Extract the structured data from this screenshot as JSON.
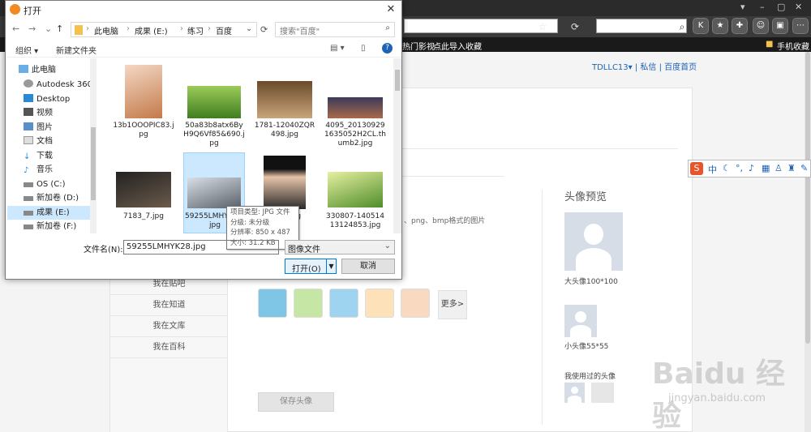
{
  "browser": {
    "bookmarks": [
      "热门影视",
      "点此导入收藏",
      "手机收藏"
    ],
    "user_links": "TDLLC13▾  |  私信  |  百度首页"
  },
  "page": {
    "sidebar": [
      "我在贴吧",
      "我在知道",
      "我在文库",
      "我在百科"
    ],
    "hint": "、png、bmp格式的图片",
    "more": "更多>",
    "save_avatar": "保存头像",
    "preview_title": "头像预览",
    "big_avatar": "大头像100*100",
    "small_avatar": "小头像55*55",
    "used_avatars": "我使用过的头像",
    "ime_label": "中",
    "watermark": "Baidu 经验",
    "watermark_url": "jingyan.baidu.com"
  },
  "dialog": {
    "title": "打开",
    "path": [
      "此电脑",
      "成果 (E:)",
      "练习",
      "百度"
    ],
    "search_placeholder": "搜索\"百度\"",
    "organize": "组织 ▾",
    "new_folder": "新建文件夹",
    "nav": [
      "此电脑",
      "Autodesk 360",
      "Desktop",
      "视频",
      "图片",
      "文档",
      "下载",
      "音乐",
      "OS (C:)",
      "新加卷 (D:)",
      "成果 (E:)",
      "新加卷 (F:)"
    ],
    "files": [
      {
        "name": "13b1OOOPIC83.jpg"
      },
      {
        "name": "50a83b8atx6ByH9Q6Vf85&690.jpg"
      },
      {
        "name": "1781-12040ZQR498.jpg"
      },
      {
        "name": "4095_201309291635052H2CL.thumb2.jpg"
      },
      {
        "name": "7183_7.jpg"
      },
      {
        "name": "59255LMHYK28.jpg"
      },
      {
        "name": "061Z.jpg"
      },
      {
        "name": "330807-14051413124853.jpg"
      }
    ],
    "tooltip": [
      "项目类型: JPG 文件",
      "分级: 未分级",
      "分辨率: 850 x 487",
      "大小: 31.2 KB"
    ],
    "filename_label": "文件名(N):",
    "filename_value": "59255LMHYK28.jpg",
    "filetype_value": "图像文件",
    "open_label": "打开(O)",
    "cancel_label": "取消"
  }
}
